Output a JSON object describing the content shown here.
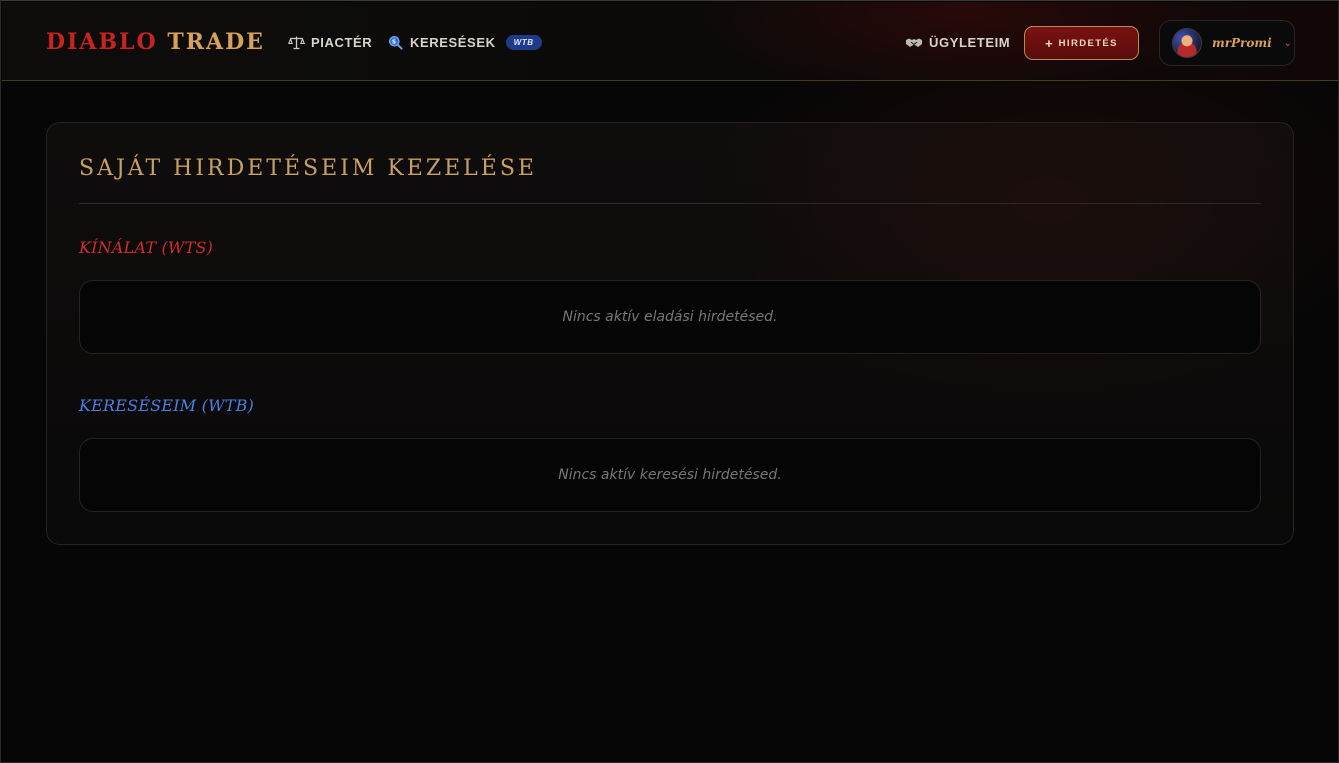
{
  "brand": {
    "part1": "DIABLO",
    "part2": "TRADE"
  },
  "nav": {
    "marketplace": {
      "label": "PIACTÉR",
      "icon": "scales-icon"
    },
    "searches": {
      "label": "KERESÉSEK",
      "icon": "search-icon",
      "badge": "WTB"
    },
    "deals": {
      "label": "ÜGYLETEIM",
      "icon": "handshake-icon"
    },
    "new_listing": {
      "plus": "+",
      "label": "HIRDETÉS"
    }
  },
  "user": {
    "name": "mrPromi",
    "chevron": "⌄"
  },
  "panel": {
    "title": "SAJÁT HIRDETÉSEIM KEZELÉSE",
    "wts": {
      "label": "KÍNÁLAT (WTS)",
      "empty": "Nincs aktív eladási hirdetésed."
    },
    "wtb": {
      "label": "KERESÉSEIM (WTB)",
      "empty": "Nincs aktív keresési hirdetésed."
    }
  },
  "colors": {
    "brand_red": "#c8231f",
    "brand_gold": "#d8a15a",
    "wts_red": "#d42a28",
    "wtb_blue": "#4a7fe6",
    "badge_blue": "#1f3a88"
  }
}
